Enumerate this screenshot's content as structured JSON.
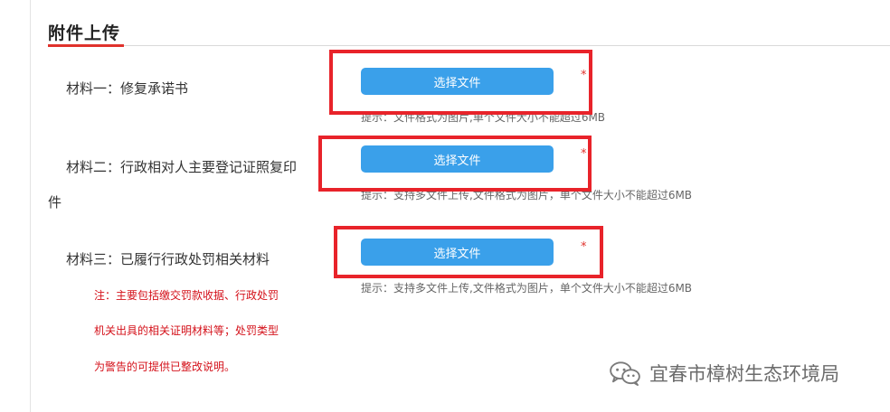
{
  "section": {
    "title": "附件上传"
  },
  "materials": [
    {
      "label": "材料一：修复承诺书",
      "button": "选择文件",
      "required_mark": "*",
      "hint": "提示：文件格式为图片,单个文件大小不能超过6MB"
    },
    {
      "label_line1": "材料二：行政相对人主要登记证照复印",
      "label_line2": "件",
      "button": "选择文件",
      "required_mark": "*",
      "hint": "提示：支持多文件上传,文件格式为图片，单个文件大小不能超过6MB"
    },
    {
      "label": "材料三：已履行行政处罚相关材料",
      "button": "选择文件",
      "required_mark": "*",
      "hint": "提示：支持多文件上传,文件格式为图片，单个文件大小不能超过6MB"
    }
  ],
  "note": {
    "line1": "注：主要包括缴交罚款收据、行政处罚",
    "line2": "机关出具的相关证明材料等；处罚类型",
    "line3": "为警告的可提供已整改说明。"
  },
  "watermark": {
    "text": "宜春市樟树生态环境局",
    "icon": "wechat-icon"
  },
  "colors": {
    "accent": "#3aa0ea",
    "highlight": "#e8232a",
    "required": "#e0322c",
    "note": "#d4111a"
  }
}
